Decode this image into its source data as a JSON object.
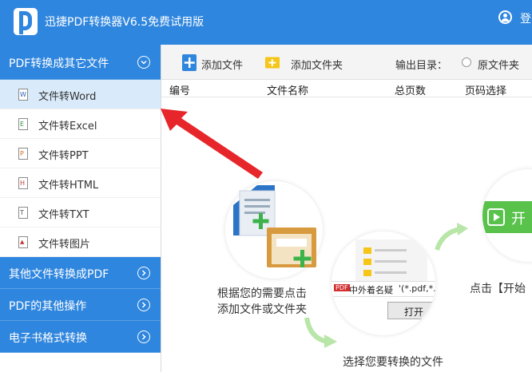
{
  "titlebar": {
    "title": "迅捷PDF转换器V6.5免费试用版",
    "user_text": "登"
  },
  "sidebar": {
    "group1": {
      "label": "PDF转换成其它文件",
      "icon": "chevron-down-icon"
    },
    "items": [
      {
        "label": "文件转Word",
        "icon": "word-file-icon",
        "letter": "W",
        "color": "#2b5fb4",
        "active": true
      },
      {
        "label": "文件转Excel",
        "icon": "excel-file-icon",
        "letter": "E",
        "color": "#2e9a3b",
        "active": false
      },
      {
        "label": "文件转PPT",
        "icon": "ppt-file-icon",
        "letter": "P",
        "color": "#d86a1a",
        "active": false
      },
      {
        "label": "文件转HTML",
        "icon": "html-file-icon",
        "letter": "H",
        "color": "#c23a3a",
        "active": false
      },
      {
        "label": "文件转TXT",
        "icon": "txt-file-icon",
        "letter": "T",
        "color": "#555555",
        "active": false
      },
      {
        "label": "文件转图片",
        "icon": "image-file-icon",
        "letter": "▲",
        "color": "#c23a3a",
        "active": false
      }
    ],
    "groups": [
      {
        "label": "其他文件转换成PDF",
        "icon": "chevron-right-icon"
      },
      {
        "label": "PDF的其他操作",
        "icon": "chevron-right-icon"
      },
      {
        "label": "电子书格式转换",
        "icon": "chevron-right-icon"
      }
    ]
  },
  "toolbar": {
    "add_file": "添加文件",
    "add_folder": "添加文件夹",
    "output_dir_label": "输出目录：",
    "output_option": "原文件夹"
  },
  "table": {
    "columns": [
      "编号",
      "文件名称",
      "总页数",
      "页码选择"
    ]
  },
  "steps": {
    "step1_line1": "根据您的需要点击",
    "step1_line2": "添加文件或文件夹",
    "step2": "选择您要转换的文件",
    "step3": "点击【开始",
    "dialog_file_name": "中外着名疑",
    "dialog_filter": "'(*.pdf,*.",
    "dialog_open": "打开",
    "start_button": "开",
    "pdf_tag": "PDF"
  },
  "colors": {
    "brand_blue": "#2f86de",
    "active_item_bg": "#d9eafa",
    "accent_green": "#58c24b",
    "arrow_red": "#e6262a"
  }
}
